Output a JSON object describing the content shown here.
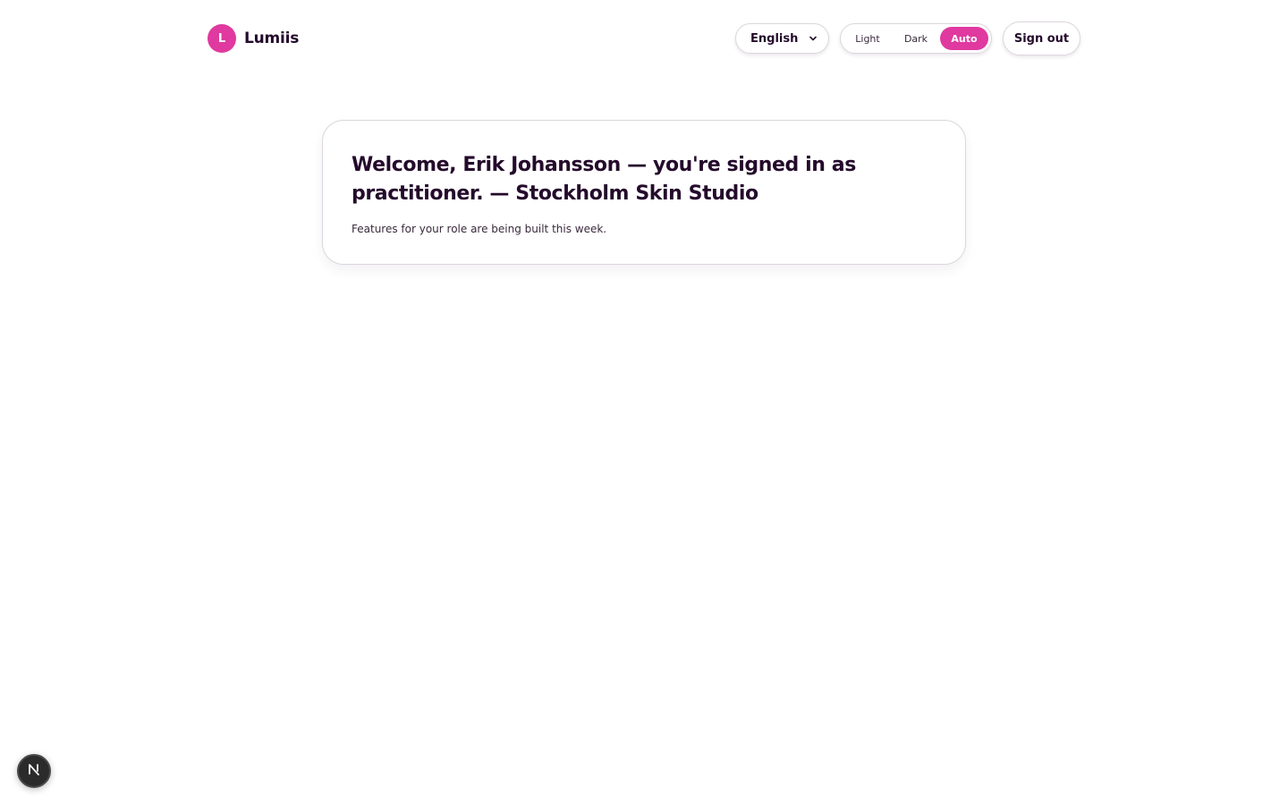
{
  "brand": {
    "logo_letter": "L",
    "name": "Lumiis",
    "color": "#e0399f"
  },
  "header": {
    "language": {
      "selected": "English",
      "icon": "chevron-down-icon"
    },
    "theme": {
      "options": [
        "Light",
        "Dark",
        "Auto"
      ],
      "selected": "Auto"
    },
    "sign_out_label": "Sign out"
  },
  "welcome": {
    "title": "Welcome, Erik Johansson — you're signed in as practitioner. — Stockholm Skin Studio",
    "subtitle": "Features for your role are being built this week."
  },
  "dev_badge": {
    "icon": "nextjs-icon",
    "letter": "N"
  }
}
